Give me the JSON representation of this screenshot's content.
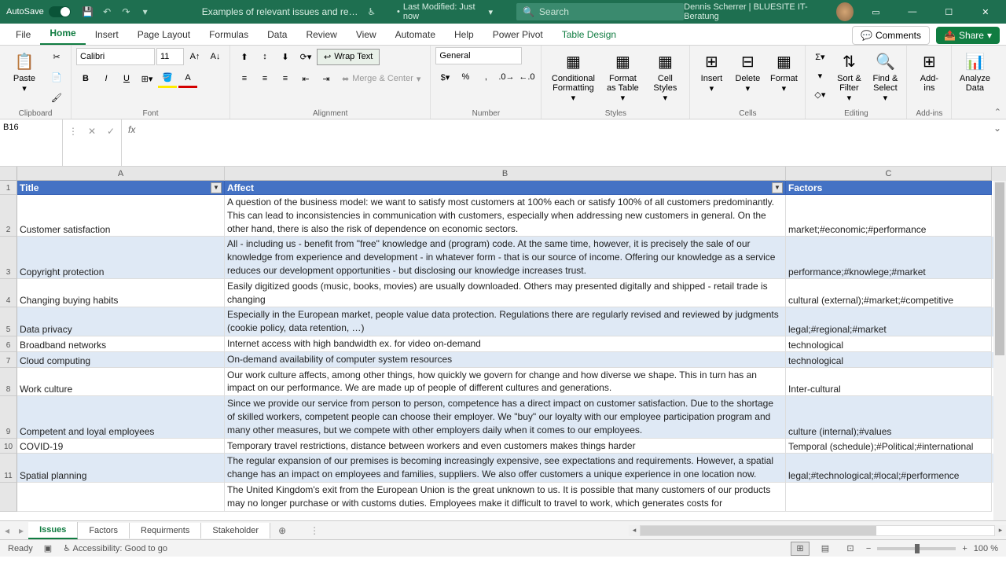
{
  "titlebar": {
    "autosave": "AutoSave",
    "doc_title": "Examples of relevant issues and require…",
    "last_modified": "Last Modified: Just now",
    "search_placeholder": "Search",
    "user_name": "Dennis Scherrer | BLUESITE IT-Beratung"
  },
  "ribbon_tabs": [
    "File",
    "Home",
    "Insert",
    "Page Layout",
    "Formulas",
    "Data",
    "Review",
    "View",
    "Automate",
    "Help",
    "Power Pivot",
    "Table Design"
  ],
  "tab_actions": {
    "comments": "Comments",
    "share": "Share"
  },
  "ribbon": {
    "clipboard": {
      "paste": "Paste",
      "label": "Clipboard"
    },
    "font": {
      "name": "Calibri",
      "size": "11",
      "label": "Font"
    },
    "alignment": {
      "wrap": "Wrap Text",
      "merge": "Merge & Center",
      "label": "Alignment"
    },
    "number": {
      "format": "General",
      "label": "Number"
    },
    "styles": {
      "cond": "Conditional Formatting",
      "fmt_table": "Format as Table",
      "cell_styles": "Cell Styles",
      "label": "Styles"
    },
    "cells": {
      "insert": "Insert",
      "delete": "Delete",
      "format": "Format",
      "label": "Cells"
    },
    "editing": {
      "sort": "Sort & Filter",
      "find": "Find & Select",
      "label": "Editing"
    },
    "addins": {
      "addins": "Add-ins",
      "analyze": "Analyze Data",
      "label": "Add-ins"
    }
  },
  "name_box": "B16",
  "columns": [
    "A",
    "B",
    "C"
  ],
  "headers": {
    "title": "Title",
    "affect": "Affect",
    "factors": "Factors"
  },
  "rows": [
    {
      "n": "2",
      "title": "Customer satisfaction",
      "affect": "A question of the business model: we want to satisfy most customers at 100% each or satisfy 100% of all customers predominantly. This can lead to inconsistencies in communication with customers, especially when addressing new customers in general. On the other hand, there is also the risk of dependence on economic sectors.",
      "factors": "market;#economic;#performance"
    },
    {
      "n": "3",
      "title": "Copyright protection",
      "affect": "All - including us - benefit from \"free\" knowledge and (program) code. At the same time, however, it is precisely the sale of our knowledge from experience and development - in whatever form - that is our source of income. Offering our knowledge as a service reduces our development opportunities - but disclosing our knowledge increases trust.",
      "factors": "performance;#knowlege;#market"
    },
    {
      "n": "4",
      "title": "Changing buying habits",
      "affect": "Easily digitized goods (music, books, movies) are usually downloaded. Others may presented digitally and shipped - retail trade is changing",
      "factors": "cultural (external);#market;#competitive"
    },
    {
      "n": "5",
      "title": "Data privacy",
      "affect": "Especially in the European market, people value data protection. Regulations there are regularly revised and reviewed by judgments (cookie policy, data retention, …)",
      "factors": "legal;#regional;#market"
    },
    {
      "n": "6",
      "title": "Broadband networks",
      "affect": "Internet access with high bandwidth ex. for video on-demand",
      "factors": "technological"
    },
    {
      "n": "7",
      "title": "Cloud computing",
      "affect": "On-demand availability of computer system resources",
      "factors": "technological"
    },
    {
      "n": "8",
      "title": "Work culture",
      "affect": "Our work culture affects, among other things, how quickly we govern for change and how diverse we shape. This in turn has an impact on our performance. We are made up of people of different cultures and generations.",
      "factors": "Inter-cultural"
    },
    {
      "n": "9",
      "title": "Competent and loyal employees",
      "affect": "Since we provide our service from person to person, competence has a direct impact on customer satisfaction. Due to the shortage of skilled workers, competent people can choose their employer. We \"buy\" our loyalty with our employee participation program and many other measures, but we compete with other employers daily when it comes to our employees.",
      "factors": "culture (internal);#values"
    },
    {
      "n": "10",
      "title": "COVID-19",
      "affect": "Temporary travel restrictions, distance between workers and even customers makes things harder",
      "factors": "Temporal (schedule);#Political;#international"
    },
    {
      "n": "11",
      "title": "Spatial planning",
      "affect": "The regular expansion of our premises is becoming increasingly expensive, see expectations and requirements. However, a spatial change has an impact on employees and families, suppliers. We also offer customers a unique experience in one location now.",
      "factors": "legal;#technological;#local;#performence"
    },
    {
      "n": "",
      "title": "",
      "affect": "The United Kingdom's exit from the European Union is the great unknown to us. It is possible that many customers of our products may no longer purchase or with customs duties. Employees make it difficult to travel to work, which generates costs for",
      "factors": ""
    }
  ],
  "sheet_tabs": [
    "Issues",
    "Factors",
    "Requirments",
    "Stakeholder"
  ],
  "statusbar": {
    "ready": "Ready",
    "accessibility": "Accessibility: Good to go",
    "zoom": "100 %"
  }
}
